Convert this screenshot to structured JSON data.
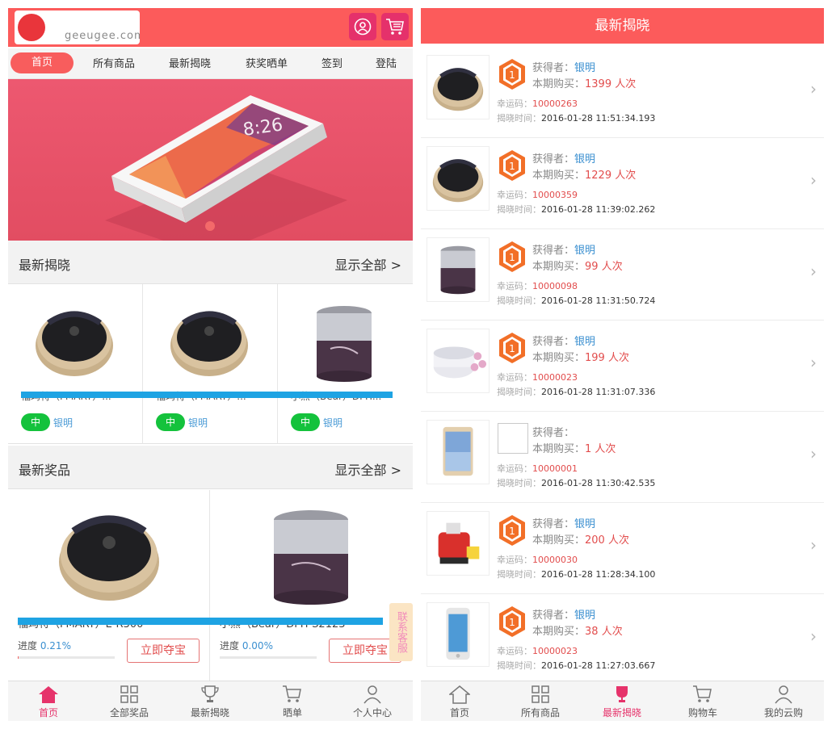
{
  "left": {
    "header": {
      "logo_text": "geeugee.com"
    },
    "nav": [
      "首页",
      "所有商品",
      "最新揭晓",
      "获奖晒单",
      "签到",
      "登陆"
    ],
    "sections": {
      "reveal": {
        "title": "最新揭晓",
        "more": "显示全部 >"
      },
      "prize": {
        "title": "最新奖品",
        "more": "显示全部 >"
      }
    },
    "reveal_items": [
      {
        "name": "福玛特（FMART）...",
        "badge": "中",
        "winner": "银明",
        "image": "robot-vacuum-icon"
      },
      {
        "name": "福玛特（FMART）...",
        "badge": "中",
        "winner": "银明",
        "image": "robot-vacuum-icon"
      },
      {
        "name": "小熊（Bear）DFH...",
        "badge": "中",
        "winner": "银明",
        "image": "lunch-box-icon"
      }
    ],
    "prize_items": [
      {
        "name": "福玛特（FMART）E-R300",
        "progress_label": "进度",
        "progress": "0.21%",
        "progress_frac": 0.0021,
        "buy": "立即夺宝",
        "image": "robot-vacuum-icon"
      },
      {
        "name": "小熊（Bear）DFH-S2123",
        "progress_label": "进度",
        "progress": "0.00%",
        "progress_frac": 0.0,
        "buy": "立即夺宝",
        "image": "lunch-box-icon"
      }
    ],
    "kefu": "联系客服",
    "tabbar": [
      {
        "label": "首页",
        "icon": "home-icon",
        "active": true
      },
      {
        "label": "全部奖品",
        "icon": "grid-icon",
        "active": false
      },
      {
        "label": "最新揭晓",
        "icon": "trophy-icon",
        "active": false
      },
      {
        "label": "晒单",
        "icon": "cart-icon",
        "active": false
      },
      {
        "label": "个人中心",
        "icon": "user-icon",
        "active": false
      }
    ]
  },
  "right": {
    "title": "最新揭晓",
    "labels": {
      "winner": "获得者：",
      "bought": "本期购买：",
      "lucky": "幸运码：",
      "time": "揭晓时间：",
      "unit": " 人次"
    },
    "rows": [
      {
        "winner": "银明",
        "bought": "1399",
        "lucky": "10000263",
        "time": "2016-01-28 11:51:34.193",
        "image": "robot-vacuum-icon",
        "hex": true
      },
      {
        "winner": "银明",
        "bought": "1229",
        "lucky": "10000359",
        "time": "2016-01-28 11:39:02.262",
        "image": "robot-vacuum-icon",
        "hex": true
      },
      {
        "winner": "银明",
        "bought": "99",
        "lucky": "10000098",
        "time": "2016-01-28 11:31:50.724",
        "image": "lunch-box-icon",
        "hex": true
      },
      {
        "winner": "银明",
        "bought": "199",
        "lucky": "10000023",
        "time": "2016-01-28 11:31:07.336",
        "image": "yogurt-maker-icon",
        "hex": true
      },
      {
        "winner": "",
        "bought": "1",
        "lucky": "10000001",
        "time": "2016-01-28 11:30:42.535",
        "image": "tablet-icon",
        "hex": false
      },
      {
        "winner": "银明",
        "bought": "200",
        "lucky": "10000030",
        "time": "2016-01-28 11:28:34.100",
        "image": "juicer-icon",
        "hex": true
      },
      {
        "winner": "银明",
        "bought": "38",
        "lucky": "10000023",
        "time": "2016-01-28 11:27:03.667",
        "image": "phone-icon",
        "hex": true
      }
    ],
    "tabbar": [
      {
        "label": "首页",
        "icon": "home-icon",
        "active": false
      },
      {
        "label": "所有商品",
        "icon": "grid-icon",
        "active": false
      },
      {
        "label": "最新揭晓",
        "icon": "trophy-icon",
        "active": true
      },
      {
        "label": "购物车",
        "icon": "cart-icon",
        "active": false
      },
      {
        "label": "我的云购",
        "icon": "user-icon",
        "active": false
      }
    ]
  },
  "colors": {
    "brand": "#fc5b5b",
    "accent": "#e6336b",
    "badge_green": "#14c23c",
    "link_blue": "#3a8fd0"
  }
}
